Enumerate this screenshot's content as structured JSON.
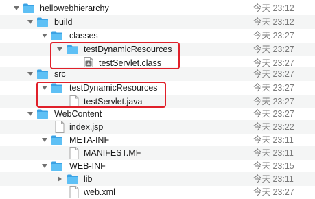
{
  "rows": [
    {
      "name": "hellowebhierarchy",
      "date": "今天 23:12"
    },
    {
      "name": "build",
      "date": "今天 23:12"
    },
    {
      "name": "classes",
      "date": "今天 23:27"
    },
    {
      "name": "testDynamicResources",
      "date": "今天 23:27"
    },
    {
      "name": "testServlet.class",
      "date": "今天 23:27"
    },
    {
      "name": "src",
      "date": "今天 23:27"
    },
    {
      "name": "testDynamicResources",
      "date": "今天 23:27"
    },
    {
      "name": "testServlet.java",
      "date": "今天 23:27"
    },
    {
      "name": "WebContent",
      "date": "今天 23:27"
    },
    {
      "name": "index.jsp",
      "date": "今天 23:22"
    },
    {
      "name": "META-INF",
      "date": "今天 23:11"
    },
    {
      "name": "MANIFEST.MF",
      "date": "今天 23:11"
    },
    {
      "name": "WEB-INF",
      "date": "今天 23:15"
    },
    {
      "name": "lib",
      "date": "今天 23:11"
    },
    {
      "name": "web.xml",
      "date": "今天 23:27"
    }
  ],
  "icons": {
    "folder": "folder-icon",
    "class_file": "class-file-icon",
    "document": "document-icon",
    "expanded": "disclosure-expanded-icon",
    "collapsed": "disclosure-collapsed-icon"
  },
  "colors": {
    "folder_front": "#5ec0f5",
    "folder_back": "#3aa2e4",
    "highlight": "#e0202a",
    "date_text": "#7a7a7a",
    "alt_row": "#f4f5f5"
  }
}
